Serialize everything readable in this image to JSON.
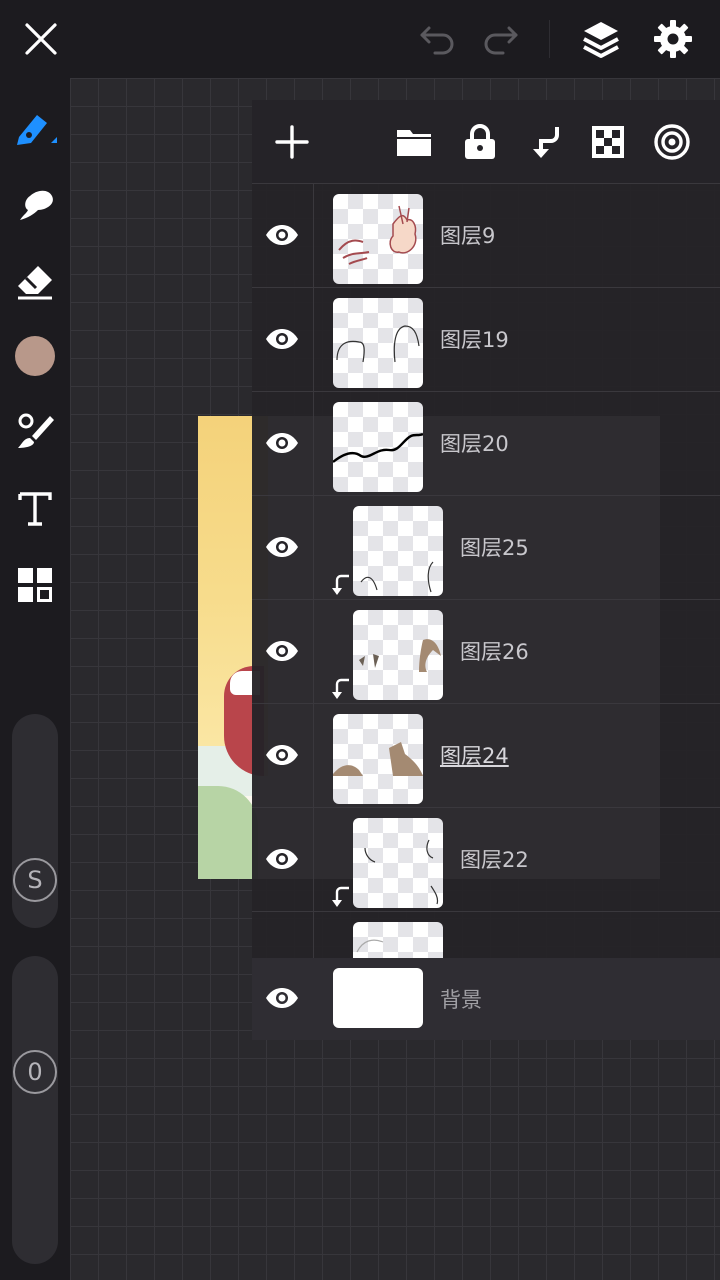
{
  "app": {
    "accent": "#1e90ff",
    "background": "#1c1b1f"
  },
  "top_bar": {
    "icons": [
      "close-icon",
      "undo-icon",
      "redo-icon",
      "layers-icon",
      "gear-icon"
    ]
  },
  "left_toolbar": {
    "tools": [
      "pen-icon",
      "smudge-icon",
      "eraser-icon",
      "color-swatch",
      "brush-select-icon",
      "text-icon",
      "transform-icon"
    ],
    "current_color": "#b8988a",
    "size_knob_label": "S",
    "opacity_knob_label": "0"
  },
  "layers_panel": {
    "toolbar_icons": [
      "plus-icon",
      "folder-icon",
      "lock-icon",
      "merge-down-icon",
      "alpha-lock-icon",
      "more-icon"
    ],
    "layers": [
      {
        "name": "图层9",
        "clipped": false,
        "visible": true
      },
      {
        "name": "图层19",
        "clipped": false,
        "visible": true
      },
      {
        "name": "图层20",
        "clipped": false,
        "visible": true
      },
      {
        "name": "图层25",
        "clipped": true,
        "visible": true
      },
      {
        "name": "图层26",
        "clipped": true,
        "visible": true
      },
      {
        "name": "图层24",
        "clipped": false,
        "visible": true,
        "active": true
      },
      {
        "name": "图层22",
        "clipped": true,
        "visible": true
      }
    ],
    "background_layer": {
      "name": "背景",
      "visible": true
    }
  }
}
